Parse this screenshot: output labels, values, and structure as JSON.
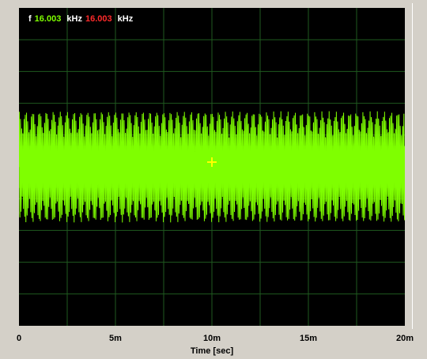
{
  "readout": {
    "label": "f",
    "value_green": "16.003",
    "unit_green": "kHz",
    "value_red": "16.003",
    "unit_red": "kHz"
  },
  "chart_data": {
    "type": "line",
    "title": "",
    "xlabel": "Time [sec]",
    "ylabel": "",
    "x_ticks": [
      "0",
      "5m",
      "10m",
      "15m",
      "20m"
    ],
    "xlim": [
      0,
      0.02
    ],
    "grid": true,
    "series": [
      {
        "color": "#7fff00",
        "description_values": {
          "frequency_hz": 16003,
          "amplitude_envelope_fraction": 0.35
        }
      }
    ],
    "cursor": {
      "symbol": "crosshair",
      "color": "#ffff00"
    }
  },
  "colors": {
    "plot_background": "#000000",
    "grid": "#1f5a1f",
    "trace": "#7fff00",
    "cursor": "#ffff00",
    "panel": "#d4d0c8"
  }
}
